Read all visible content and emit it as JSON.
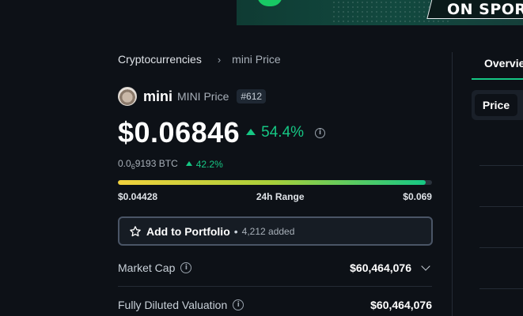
{
  "banner": {
    "text": "ON SPOR"
  },
  "breadcrumb": {
    "parent": "Cryptocurrencies",
    "separator": "›",
    "current": "mini Price"
  },
  "coin": {
    "name": "mini",
    "subtitle": "MINI Price",
    "rank": "#612"
  },
  "price": {
    "value": "$0.06846",
    "change": "54.4%",
    "direction": "up",
    "info_icon": "i"
  },
  "btc": {
    "prefix": "0.0",
    "zeros": "6",
    "digits": "9193 BTC",
    "change": "42.2%"
  },
  "range": {
    "low": "$0.04428",
    "label": "24h Range",
    "high": "$0.069",
    "position_fraction": 0.98
  },
  "portfolio": {
    "label": "Add to Portfolio",
    "dot": "•",
    "added": "4,212 added"
  },
  "stats": [
    {
      "label": "Market Cap",
      "value": "$60,464,076",
      "expandable": true
    },
    {
      "label": "Fully Diluted Valuation",
      "value": "$60,464,076",
      "expandable": false
    }
  ],
  "right_panel": {
    "tab": "Overview",
    "toggle": "Price"
  },
  "colors": {
    "background": "#0d1117",
    "positive": "#16c784",
    "border": "#4a5566"
  }
}
